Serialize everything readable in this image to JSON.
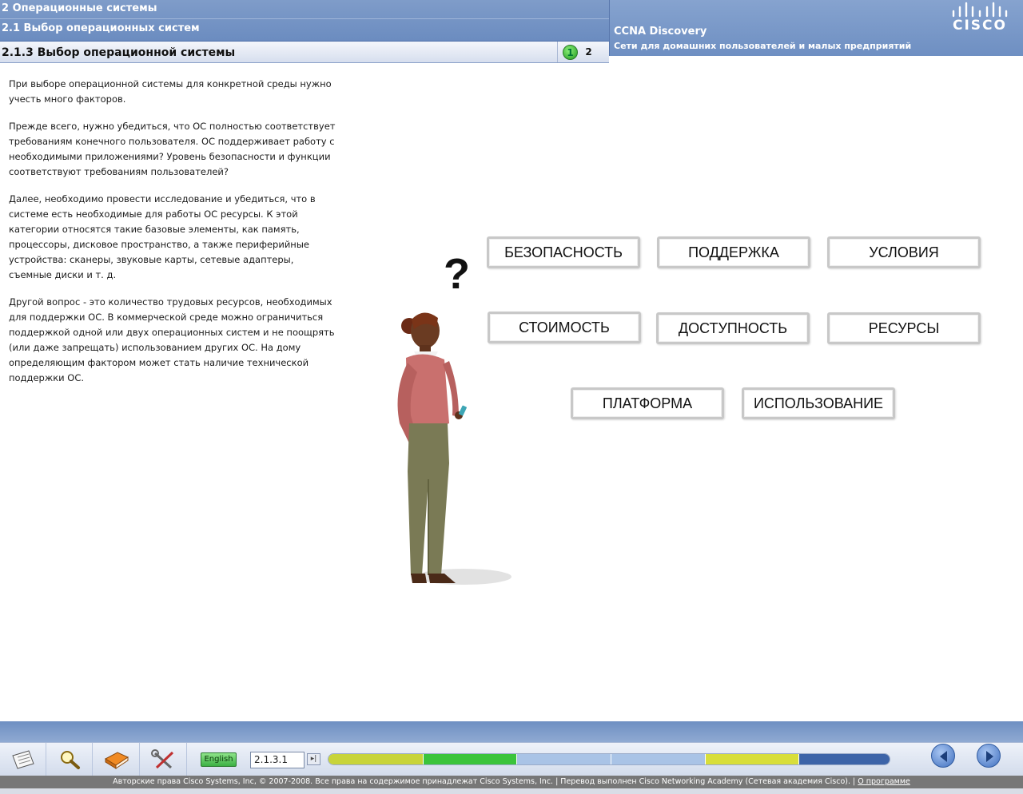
{
  "header": {
    "chapter": "2 Операционные системы",
    "section": "2.1 Выбор операционных систем",
    "page_title": "2.1.3 Выбор операционной системы",
    "pages": [
      "1",
      "2"
    ],
    "course_name": "CCNA Discovery",
    "course_subtitle": "Сети для домашних пользователей и малых предприятий",
    "logo_text": "CISCO"
  },
  "content": {
    "paragraphs": [
      "При выборе операционной системы для конкретной среды нужно учесть много факторов.",
      "Прежде всего, нужно убедиться, что ОС полностью соответствует требованиям конечного пользователя. ОС поддерживает работу с необходимыми приложениями? Уровень безопасности и функции соответствуют требованиям пользователей?",
      "Далее, необходимо провести исследование и убедиться, что в системе есть необходимые для работы ОС ресурсы. К этой категории относятся такие базовые элементы, как память, процессоры, дисковое пространство, а также периферийные устройства: сканеры, звуковые карты, сетевые адаптеры, съемные диски и т. д.",
      "Другой вопрос - это количество трудовых ресурсов, необходимых для поддержки ОС. В коммерческой среде можно ограничиться поддержкой одной или двух операционных систем и не поощрять (или даже запрещать) использованием других ОС. На дому определяющим фактором может стать наличие технической поддержки ОС."
    ],
    "question_mark": "?",
    "factors": [
      "БЕЗОПАСНОСТЬ",
      "ПОДДЕРЖКА",
      "УСЛОВИЯ",
      "СТОИМОСТЬ",
      "ДОСТУПНОСТЬ",
      "РЕСУРСЫ",
      "ПЛАТФОРМА",
      "ИСПОЛЬЗОВАНИЕ"
    ]
  },
  "toolbar": {
    "tools": [
      "notes-icon",
      "search-icon",
      "glossary-book-icon",
      "tools-icon"
    ],
    "language_button": "English",
    "location_value": "2.1.3.1",
    "go_symbol": "▸|",
    "progress_colors": [
      "#c8d43a",
      "#3bc43b",
      "#a9c3e6",
      "#a9c3e6",
      "#d8de3a",
      "#3d64a8"
    ],
    "back_icon": "back-arrow-icon",
    "forward_icon": "forward-arrow-icon"
  },
  "footer": {
    "text": "Авторские права Cisco Systems, Inc, © 2007-2008. Все права на содержимое принадлежат Cisco Systems, Inc. | Перевод выполнен Cisco Networking Academy (Сетевая академия Cisco). |",
    "about_link": "О программе"
  }
}
